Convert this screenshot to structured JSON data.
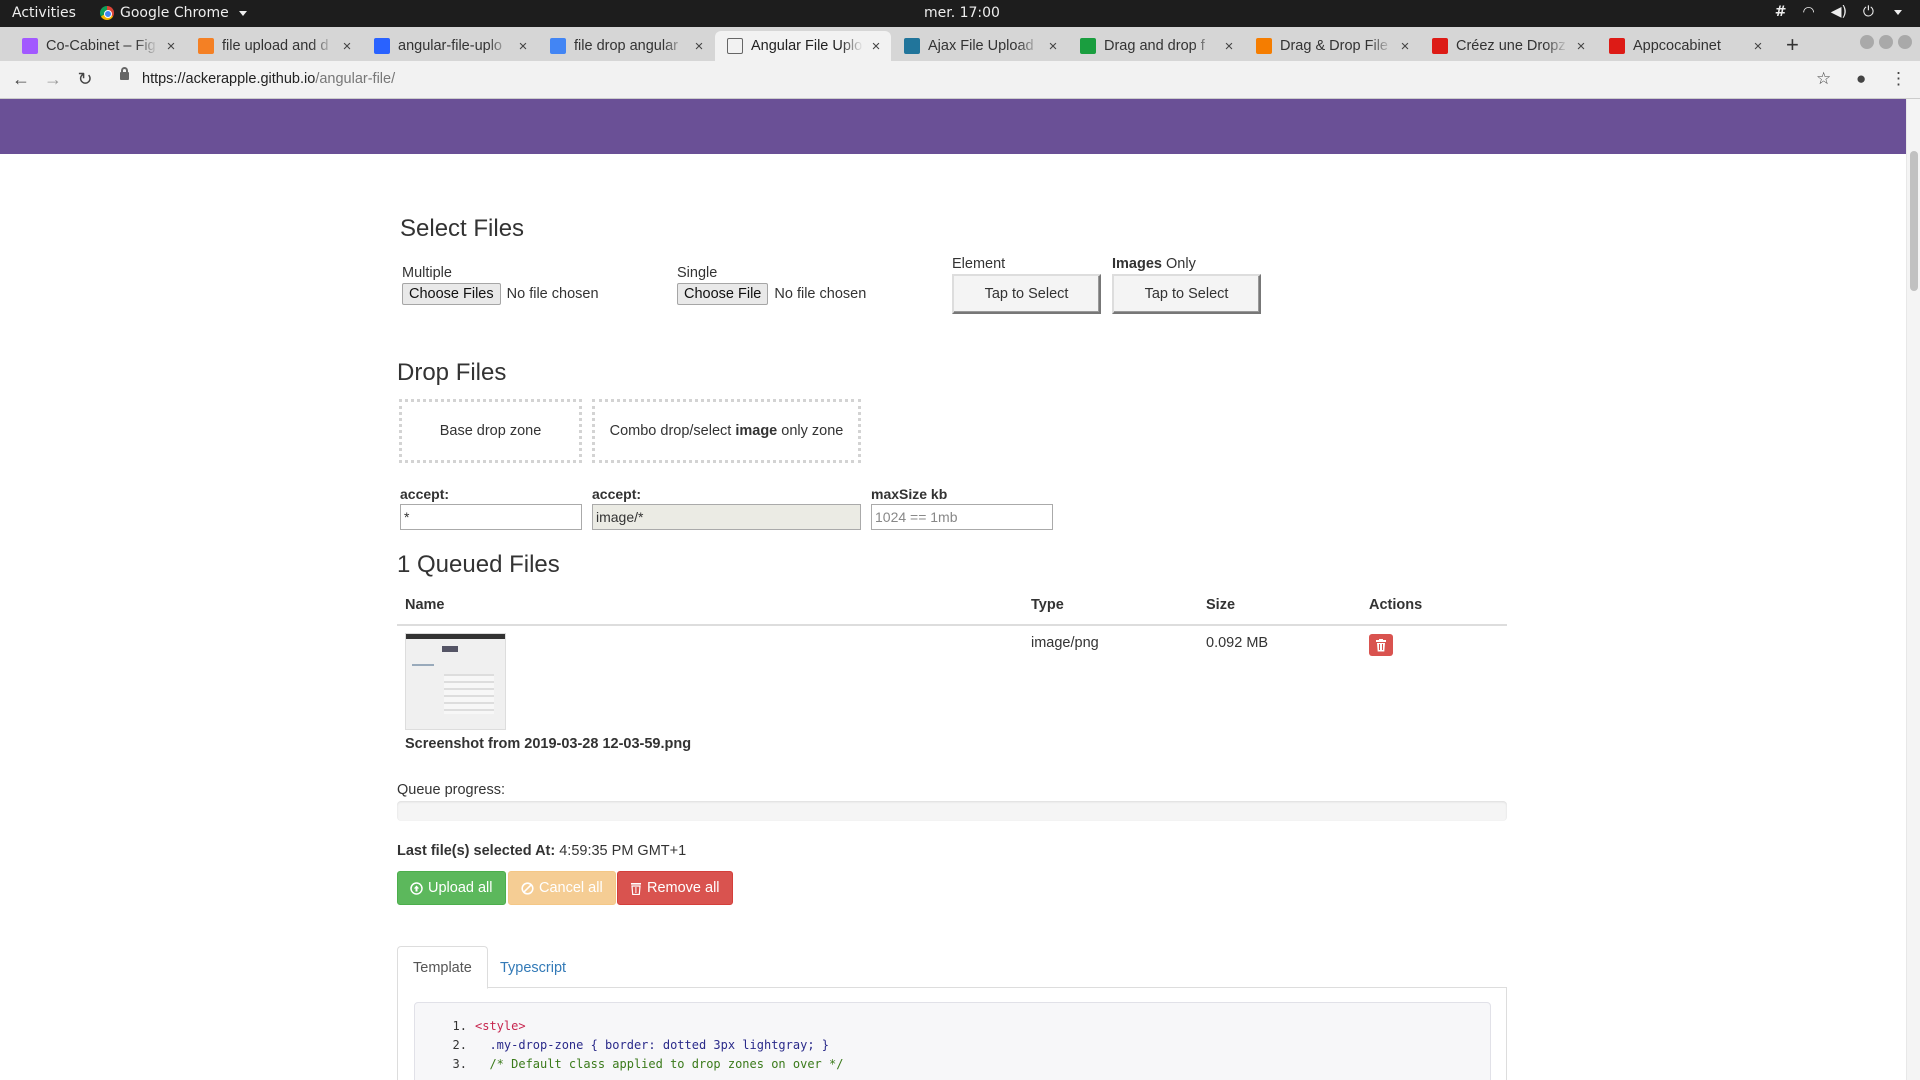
{
  "system_bar": {
    "activities": "Activities",
    "app_name": "Google Chrome",
    "clock": "mer. 17:00"
  },
  "tabs": [
    {
      "title": "Co-Cabinet – Fig",
      "color": "#a259ff",
      "icon": "figma-icon"
    },
    {
      "title": "file upload and d",
      "color": "#f48024",
      "icon": "stackoverflow-icon"
    },
    {
      "title": "angular-file-uplo",
      "color": "#2962ff",
      "icon": "bolt-icon"
    },
    {
      "title": "file drop angular",
      "color": "#4285f4",
      "icon": "google-icon"
    },
    {
      "title": "Angular File Uplo",
      "color": "#666666",
      "icon": "document-icon"
    },
    {
      "title": "Ajax File Upload",
      "color": "#21759b",
      "icon": "wordpress-icon"
    },
    {
      "title": "Drag and drop f",
      "color": "#1a9e3f",
      "icon": "brackets-icon"
    },
    {
      "title": "Drag & Drop File",
      "color": "#f57d00",
      "icon": "blogger-icon"
    },
    {
      "title": "Créez une Dropz",
      "color": "#dd1b16",
      "icon": "angular-icon"
    },
    {
      "title": "Appcocabinet",
      "color": "#dd1b16",
      "icon": "angular-icon"
    }
  ],
  "url": {
    "host": "https://ackerapple.github.io",
    "path": "/angular-file/"
  },
  "select_files": {
    "heading": "Select Files",
    "multiple_label": "Multiple",
    "multiple_button": "Choose Files",
    "multiple_status": "No file chosen",
    "single_label": "Single",
    "single_button": "Choose File",
    "single_status": "No file chosen",
    "element_label": "Element",
    "element_button": "Tap to Select",
    "images_label_bold": "Images",
    "images_label_rest": " Only",
    "images_button": "Tap to Select"
  },
  "drop_files": {
    "heading": "Drop Files",
    "base_zone": "Base drop zone",
    "combo_zone_pre": "Combo drop/select ",
    "combo_zone_bold": "image",
    "combo_zone_post": " only zone",
    "accept1_label": "accept:",
    "accept1_value": "*",
    "accept2_label": "accept:",
    "accept2_value": "image/*",
    "maxsize_label": "maxSize kb",
    "maxsize_placeholder": "1024 == 1mb"
  },
  "queue": {
    "heading": "1 Queued Files",
    "columns": [
      "Name",
      "Type",
      "Size",
      "Actions"
    ],
    "rows": [
      {
        "name": "Screenshot from 2019-03-28 12-03-59.png",
        "type": "image/png",
        "size": "0.092 MB"
      }
    ],
    "progress_label": "Queue progress:",
    "progress_value": 0,
    "last_selected_label": "Last file(s) selected At:",
    "last_selected_value": "4:59:35 PM GMT+1",
    "upload_all": "Upload all",
    "cancel_all": "Cancel all",
    "remove_all": "Remove all"
  },
  "code_tabs": {
    "template": "Template",
    "typescript": "Typescript"
  },
  "code_lines": [
    {
      "n": "1.",
      "t": "<style>"
    },
    {
      "n": "2.",
      "t": "  .my-drop-zone { border: dotted 3px lightgray; }"
    },
    {
      "n": "3.",
      "t": "  /* Default class applied to drop zones on over */"
    }
  ]
}
